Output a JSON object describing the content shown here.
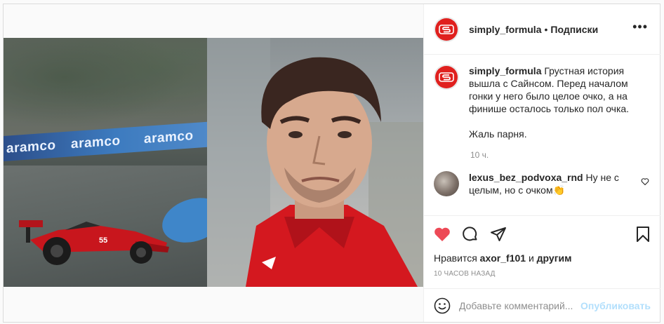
{
  "post": {
    "username": "simply_formula",
    "separator": "•",
    "follow_label": "Подписки",
    "more_icon": "more-horizontal-icon",
    "brand_color": "#e0201e",
    "image": {
      "left_banner_text": "aramco",
      "car_number": "55"
    }
  },
  "caption": {
    "username": "simply_formula",
    "text_1": "Грустная история вышла с Сайнсом. Перед началом гонки у него было целое очко, а на финише осталось только пол очка.",
    "text_2": "Жаль парня.",
    "time": "10 ч."
  },
  "comments": [
    {
      "username": "lexus_bez_podvoxa_rnd",
      "text": "Ну не с целым, но с очком👏"
    }
  ],
  "actions": {
    "liked": true,
    "like_color": "#ed4956",
    "likes_prefix": "Нравится",
    "likes_user": "axor_f101",
    "likes_joiner": "и",
    "likes_others": "другим",
    "posted_ago": "10 часов назад"
  },
  "add_comment": {
    "placeholder": "Добавьте комментарий...",
    "publish_label": "Опубликовать"
  }
}
